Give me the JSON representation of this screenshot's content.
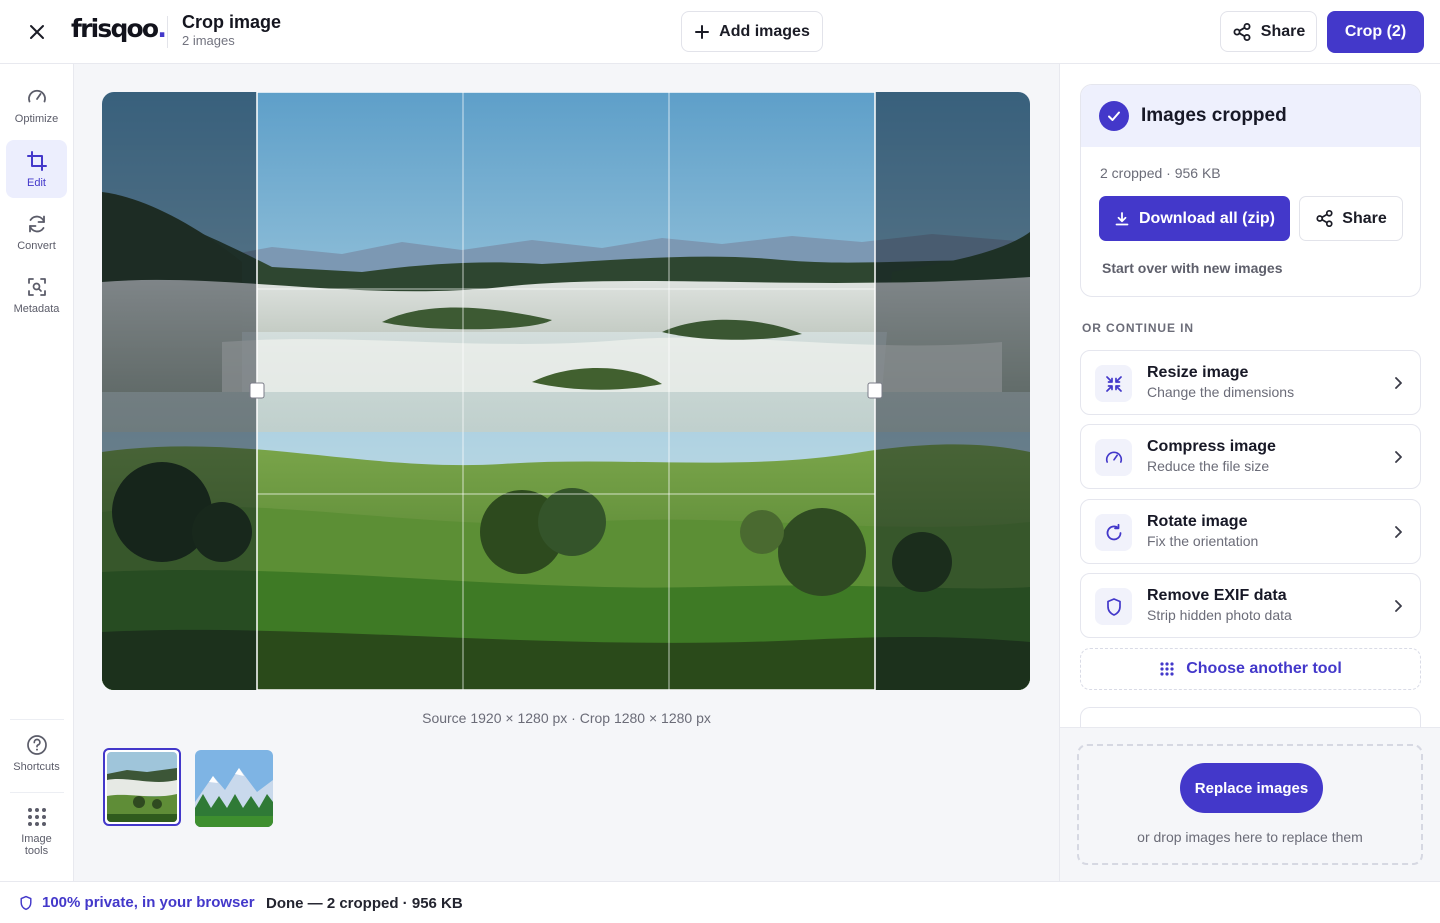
{
  "header": {
    "brand": "frisqoo",
    "brand_dot": ".",
    "title": "Crop image",
    "subtitle": "2 images",
    "add_images_label": "Add images",
    "share_label": "Share",
    "crop_label": "Crop (2)"
  },
  "rail": {
    "items": [
      {
        "label": "Optimize",
        "icon": "gauge-icon"
      },
      {
        "label": "Edit",
        "icon": "crop-icon",
        "active": true
      },
      {
        "label": "Convert",
        "icon": "refresh-icon"
      },
      {
        "label": "Metadata",
        "icon": "scan-icon"
      }
    ],
    "shortcuts_label": "Shortcuts",
    "image_tools_label_1": "Image",
    "image_tools_label_2": "tools"
  },
  "canvas": {
    "crop_caption": "Source 1920 × 1280 px · Crop 1280 × 1280 px",
    "crop_selection": {
      "left_fraction": 0.1667,
      "right_fraction": 0.8333
    }
  },
  "result": {
    "title": "Images cropped",
    "meta": "2 cropped · 956 KB",
    "download_label": "Download all (zip)",
    "share_label": "Share",
    "start_over_label": "Start over with new images"
  },
  "continue": {
    "section_label": "OR CONTINUE IN",
    "tools": [
      {
        "title": "Resize image",
        "desc": "Change the dimensions",
        "icon": "shrink-icon"
      },
      {
        "title": "Compress image",
        "desc": "Reduce the file size",
        "icon": "gauge-icon"
      },
      {
        "title": "Rotate image",
        "desc": "Fix the orientation",
        "icon": "rotate-icon"
      },
      {
        "title": "Remove EXIF data",
        "desc": "Strip hidden photo data",
        "icon": "shield-icon"
      }
    ],
    "choose_label": "Choose another tool"
  },
  "dropzone": {
    "replace_label": "Replace images",
    "hint": "or drop images here to replace them"
  },
  "status": {
    "private_label": "100% private, in your browser",
    "done_label": "Done — 2 cropped · 956 KB"
  },
  "colors": {
    "accent": "#4338ca",
    "accent_soft": "#eef0fd",
    "canvas_bg": "#f5f6f9"
  }
}
